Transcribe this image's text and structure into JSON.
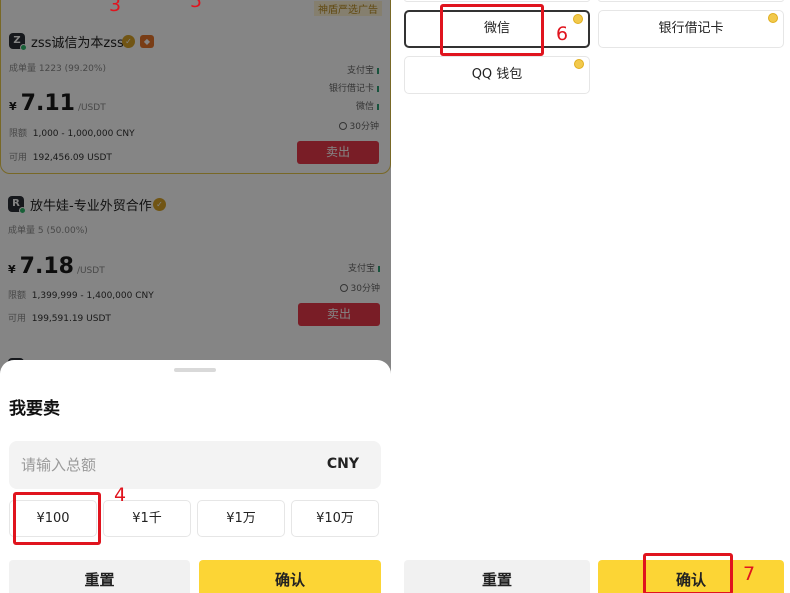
{
  "left": {
    "cards": [
      {
        "promo_tag": "神盾严选广告",
        "avatar": "Z",
        "merchant": "zss诚信为本zss",
        "orders": "成单量 1223 (99.20%)",
        "yen": "¥",
        "price": "7.11",
        "unit": "/USDT",
        "limit_label": "限额",
        "limit": "1,000 - 1,000,000 CNY",
        "avail_label": "可用",
        "avail": "192,456.09 USDT",
        "pay": [
          "支付宝",
          "银行借记卡",
          "微信"
        ],
        "time": "30分钟",
        "sell": "卖出"
      },
      {
        "avatar": "R",
        "merchant": "放牛娃-专业外贸合作",
        "orders": "成单量 5 (50.00%)",
        "yen": "¥",
        "price": "7.18",
        "unit": "/USDT",
        "limit_label": "限额",
        "limit": "1,399,999 - 1,400,000 CNY",
        "avail_label": "可用",
        "avail": "199,591.19 USDT",
        "pay": [
          "支付宝"
        ],
        "time": "30分钟",
        "sell": "卖出"
      }
    ],
    "sheet": {
      "title": "我要卖",
      "amount_placeholder": "请输入总额",
      "currency": "CNY",
      "quick_amounts": [
        "¥100",
        "¥1千",
        "¥1万",
        "¥10万"
      ],
      "reset": "重置",
      "confirm": "确认"
    }
  },
  "right": {
    "payment_methods": [
      "微信",
      "银行借记卡",
      "QQ 钱包"
    ],
    "reset": "重置",
    "confirm": "确认"
  },
  "annotations": [
    "3",
    "5",
    "4",
    "6",
    "7"
  ],
  "colors": {
    "accent_yellow": "#fcd535",
    "sell_red": "#e8394a",
    "annotation_red": "#e0141e",
    "highlight_border": "#e7c74a"
  }
}
